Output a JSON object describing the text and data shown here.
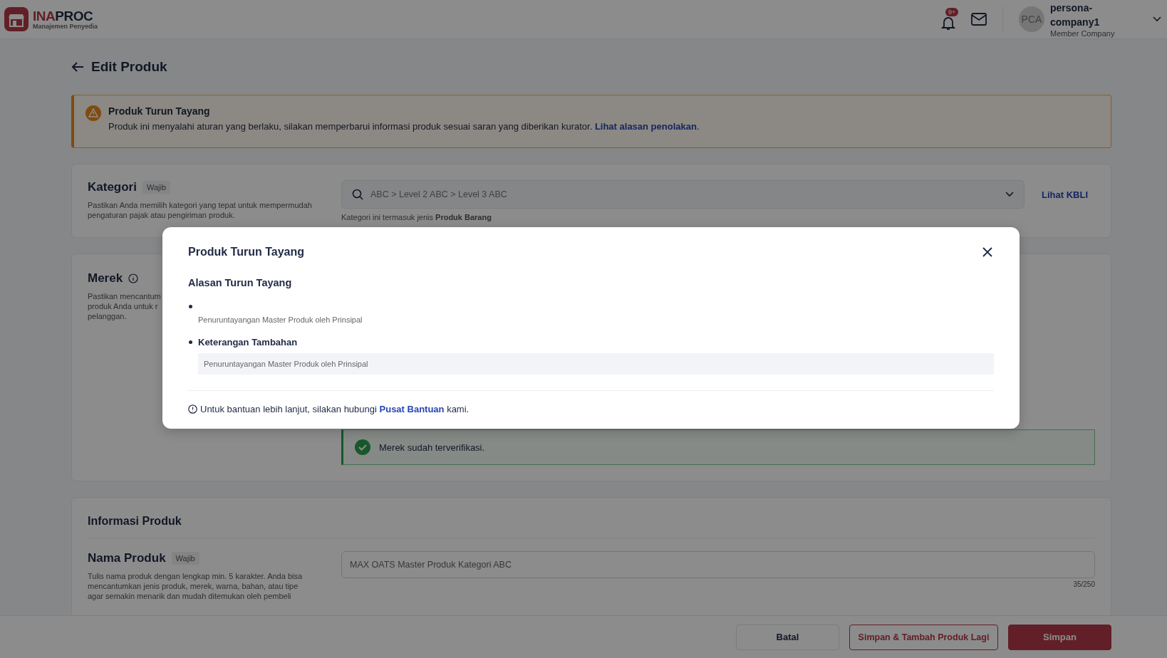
{
  "header": {
    "logo": {
      "name_parts": [
        "INA",
        "PROC"
      ],
      "subtitle": "Manajemen Penyedia"
    },
    "notification_badge": "9+",
    "user": {
      "initials": "PCA",
      "name": "persona-company1",
      "role": "Member Company"
    }
  },
  "page_title": "Edit Produk",
  "alert": {
    "title": "Produk Turun Tayang",
    "message": "Produk ini menyalahi aturan yang berlaku, silakan memperbarui informasi produk sesuai saran yang diberikan kurator.",
    "link": "Lihat alasan penolakan",
    "after_link": "."
  },
  "kategori": {
    "label": "Kategori",
    "badge": "Wajib",
    "description": "Pastikan Anda memilih kategori yang tepat untuk mempermudah pengaturan pajak atau pengiriman produk.",
    "value": "ABC > Level 2 ABC > Level 3 ABC",
    "hint": "Kategori ini termasuk jenis **Produk Barang**",
    "link": "Lihat KBLI"
  },
  "merek": {
    "label": "Merek",
    "description_lines": [
      "Pastikan mencantum",
      "produk Anda untuk r",
      "pelanggan."
    ],
    "verified_message": "Merek sudah terverifikasi."
  },
  "informasi_produk": {
    "title": "Informasi Produk",
    "nama_produk": {
      "label": "Nama Produk",
      "badge": "Wajib",
      "description": "Tulis nama produk dengan lengkap min. 5 karakter. Anda bisa mencantumkan jenis produk, merek, warna, bahan, atau tipe agar semakin menarik dan mudah ditemukan oleh pembeli",
      "value": "MAX OATS Master Produk Kategori ABC",
      "counter": "35/250"
    }
  },
  "footer_buttons": [
    {
      "label": "Batal",
      "kind": "plain"
    },
    {
      "label": "Simpan & Tambah Produk Lagi",
      "kind": "outline"
    },
    {
      "label": "Simpan",
      "kind": "primary"
    }
  ],
  "modal": {
    "title": "Produk Turun Tayang",
    "section_title": "Alasan Turun Tayang",
    "reasons": [
      {
        "text": "Penuruntayangan Master Produk oleh Prinsipal",
        "kind": "plain"
      },
      {
        "title": "Keterangan Tambahan",
        "text": "Penuruntayangan Master Produk oleh Prinsipal",
        "kind": "boxed"
      }
    ],
    "help_text": "Untuk bantuan lebih lanjut, silakan hubungi",
    "help_link": "Pusat Bantuan",
    "help_after": "kami."
  }
}
